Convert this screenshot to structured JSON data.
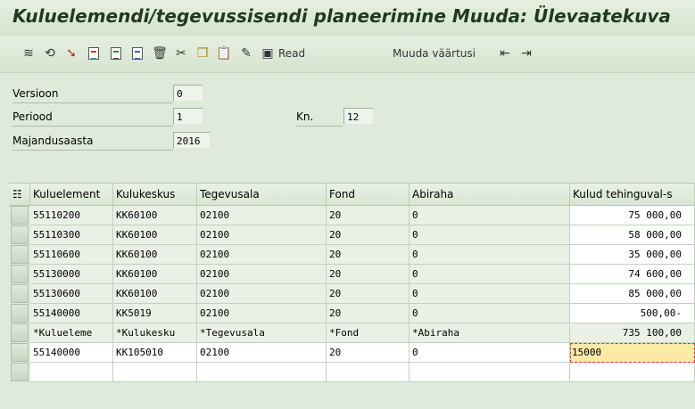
{
  "window": {
    "title": "Kuluelemendi/tegevussisendi planeerimine Muuda: Ülevaatekuva"
  },
  "toolbar": {
    "icons": [
      "overview-icon",
      "other-plan-icon",
      "select-icon",
      "doc-icon",
      "doc-green-icon",
      "doc-blue-icon",
      "delete-icon",
      "cut-icon",
      "copy-icon",
      "paste-icon",
      "edit-icon",
      "read-icon"
    ],
    "read_label": "Read",
    "change_values_label": "Muuda väärtusi",
    "prev_icon": "prev-page-icon",
    "next_icon": "next-page-icon"
  },
  "header": {
    "version_label": "Versioon",
    "version_value": "0",
    "period_label": "Periood",
    "period_value": "1",
    "kn_label": "Kn.",
    "kn_value": "12",
    "year_label": "Majandusaasta",
    "year_value": "2016"
  },
  "table": {
    "columns": [
      "Kuluelement",
      "Kulukeskus",
      "Tegevusala",
      "Fond",
      "Abiraha",
      "Kulud tehinguval-s"
    ],
    "rows": [
      [
        "55110200",
        "KK60100",
        "02100",
        "20",
        "0",
        "75 000,00"
      ],
      [
        "55110300",
        "KK60100",
        "02100",
        "20",
        "0",
        "58 000,00"
      ],
      [
        "55110600",
        "KK60100",
        "02100",
        "20",
        "0",
        "35 000,00"
      ],
      [
        "55130000",
        "KK60100",
        "02100",
        "20",
        "0",
        "74 600,00"
      ],
      [
        "55130600",
        "KK60100",
        "02100",
        "20",
        "0",
        "85 000,00"
      ],
      [
        "55140000",
        "KK5019",
        "02100",
        "20",
        "0",
        "500,00-"
      ]
    ],
    "sum_row": [
      "*Kulueleme",
      "*Kulukesku",
      "*Tegevusala",
      "*Fond",
      "*Abiraha",
      "735 100,00"
    ],
    "new_row": [
      "55140000",
      "KK105010",
      "02100",
      "20",
      "0",
      "15000"
    ]
  }
}
